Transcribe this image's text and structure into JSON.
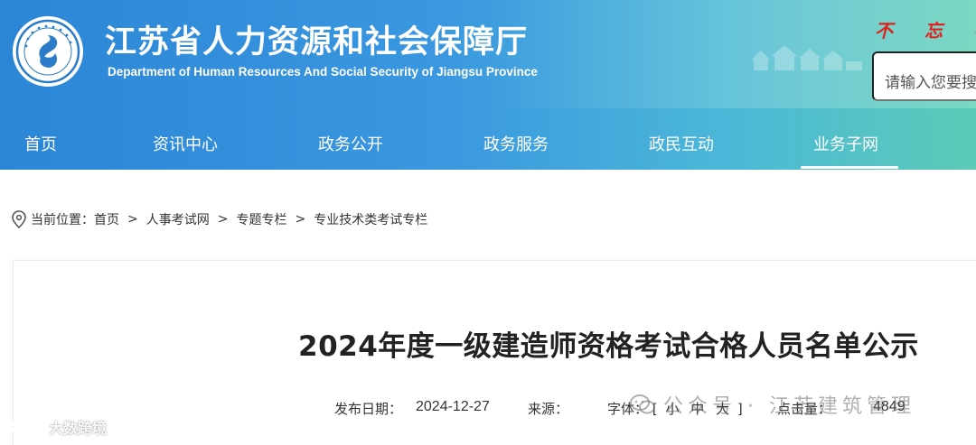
{
  "header": {
    "title_cn": "江苏省人力资源和社会保障厅",
    "title_en": "Department of Human Resources And Social Security of Jiangsu Province",
    "slogan": "不 忘 初",
    "logo_ring_text": "江苏省人力资源和社会保障厅",
    "search_placeholder": "请输入您要搜",
    "colors": {
      "banner_start": "#2b86d6",
      "banner_end": "#5ccbb6",
      "slogan": "#e0201c"
    }
  },
  "nav": {
    "items": [
      {
        "label": "首页"
      },
      {
        "label": "资讯中心"
      },
      {
        "label": "政务公开"
      },
      {
        "label": "政务服务"
      },
      {
        "label": "政民互动"
      },
      {
        "label": "业务子网"
      }
    ],
    "active": "业务子网"
  },
  "breadcrumb": {
    "prefix": "当前位置：",
    "items": [
      "首页",
      "人事考试网",
      "专题专栏",
      "专业技术类考试专栏"
    ],
    "separator": ">"
  },
  "article": {
    "title": "2024年度一级建造师资格考试合格人员名单公示",
    "publish_label": "发布日期：",
    "publish_date": "2024-12-27",
    "source_label": "来源：",
    "source_value": "",
    "font_label": "字体：",
    "font_bracket_open": "[",
    "font_small": "小",
    "font_medium": "中",
    "font_large": "大",
    "font_bracket_close": "]",
    "clicks_label": "点击量：",
    "clicks_value": "4849"
  },
  "watermarks": {
    "center": "公众号 · 江苏建筑管理",
    "left": "大数跨境"
  }
}
